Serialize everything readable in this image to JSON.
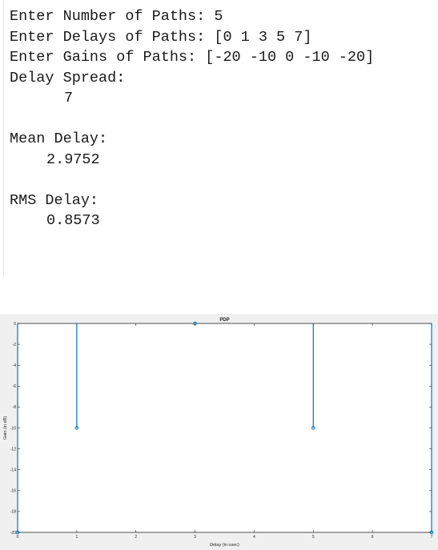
{
  "console": {
    "lines": [
      {
        "prompt": "Enter Number of Paths: ",
        "value": "5"
      },
      {
        "prompt": "Enter Delays of Paths: ",
        "value": "[0 1 3 5 7]"
      },
      {
        "prompt": "Enter Gains of Paths: ",
        "value": "[-20 -10 0 -10 -20]"
      }
    ],
    "delay_spread_label": "Delay Spread:",
    "delay_spread_value": "7",
    "mean_delay_label": "Mean Delay:",
    "mean_delay_value": "2.9752",
    "rms_delay_label": "RMS Delay:",
    "rms_delay_value": "0.8573"
  },
  "chart_data": {
    "type": "stem",
    "title": "PDP",
    "xlabel": "Delay (in usec)",
    "ylabel": "Gain (in dB)",
    "xlim": [
      0,
      7
    ],
    "ylim": [
      -20,
      0
    ],
    "xticks": [
      0,
      1,
      2,
      3,
      4,
      5,
      6,
      7
    ],
    "yticks": [
      0,
      -2,
      -4,
      -6,
      -8,
      -10,
      -12,
      -14,
      -16,
      -18,
      -20
    ],
    "x": [
      0,
      1,
      3,
      5,
      7
    ],
    "y": [
      -20,
      -10,
      0,
      -10,
      -20
    ],
    "baseline": 0,
    "color": "#0072BD",
    "grid": false
  }
}
